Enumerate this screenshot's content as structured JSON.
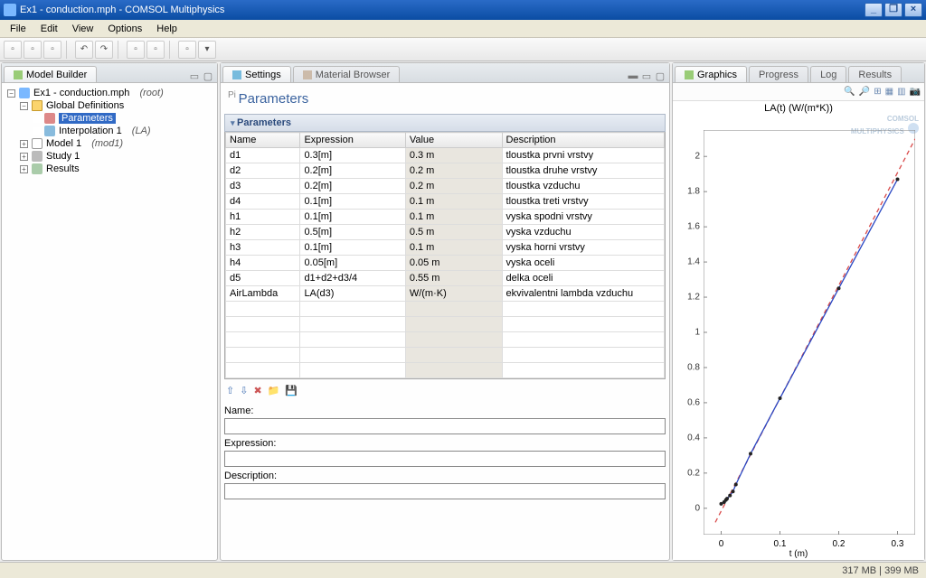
{
  "window": {
    "title": "Ex1 - conduction.mph - COMSOL Multiphysics"
  },
  "menu": [
    "File",
    "Edit",
    "View",
    "Options",
    "Help"
  ],
  "panels": {
    "model_builder": "Model Builder",
    "settings": "Settings",
    "material_browser": "Material Browser",
    "graphics": "Graphics",
    "progress": "Progress",
    "log": "Log",
    "results": "Results"
  },
  "tree": {
    "root": "Ex1 - conduction.mph",
    "root_suffix": "(root)",
    "global_defs": "Global Definitions",
    "parameters": "Parameters",
    "interpolation": "Interpolation 1",
    "interpolation_suffix": "(LA)",
    "model": "Model 1",
    "model_suffix": "(mod1)",
    "study": "Study 1",
    "results": "Results"
  },
  "params_title": "Parameters",
  "section_title": "Parameters",
  "columns": {
    "name": "Name",
    "expression": "Expression",
    "value": "Value",
    "description": "Description"
  },
  "rows": [
    {
      "n": "d1",
      "e": "0.3[m]",
      "v": "0.3 m",
      "d": "tloustka prvni vrstvy"
    },
    {
      "n": "d2",
      "e": "0.2[m]",
      "v": "0.2 m",
      "d": "tloustka druhe vrstvy"
    },
    {
      "n": "d3",
      "e": "0.2[m]",
      "v": "0.2 m",
      "d": "tloustka vzduchu"
    },
    {
      "n": "d4",
      "e": "0.1[m]",
      "v": "0.1 m",
      "d": "tloustka treti vrstvy"
    },
    {
      "n": "h1",
      "e": "0.1[m]",
      "v": "0.1 m",
      "d": "vyska spodni vrstvy"
    },
    {
      "n": "h2",
      "e": "0.5[m]",
      "v": "0.5 m",
      "d": "vyska vzduchu"
    },
    {
      "n": "h3",
      "e": "0.1[m]",
      "v": "0.1 m",
      "d": "vyska horni vrstvy"
    },
    {
      "n": "h4",
      "e": "0.05[m]",
      "v": "0.05 m",
      "d": "vyska oceli"
    },
    {
      "n": "d5",
      "e": "d1+d2+d3/4",
      "v": "0.55 m",
      "d": "delka oceli"
    },
    {
      "n": "AirLambda",
      "e": "LA(d3)",
      "v": "W/(m·K)",
      "d": "ekvivalentni lambda vzduchu"
    }
  ],
  "form": {
    "name": "Name:",
    "expression": "Expression:",
    "description": "Description:"
  },
  "status": "317 MB | 399 MB",
  "chart_data": {
    "type": "line",
    "title": "LA(t) (W/(m*K))",
    "xlabel": "t (m)",
    "xlim": [
      -0.03,
      0.33
    ],
    "ylim": [
      -0.15,
      2.15
    ],
    "yticks": [
      0,
      0.2,
      0.4,
      0.6,
      0.8,
      1,
      1.2,
      1.4,
      1.6,
      1.8,
      2
    ],
    "xticks": [
      0,
      0.1,
      0.2,
      0.3
    ],
    "series": [
      {
        "name": "red-dashed",
        "color": "#d94a4a",
        "dash": true,
        "x": [
          -0.01,
          0.33
        ],
        "y": [
          -0.08,
          2.1
        ]
      },
      {
        "name": "blue-line",
        "color": "#2947c3",
        "dash": false,
        "x": [
          0,
          0.005,
          0.008,
          0.01,
          0.015,
          0.02,
          0.025,
          0.05,
          0.1,
          0.2,
          0.3
        ],
        "y": [
          0.025,
          0.035,
          0.047,
          0.055,
          0.073,
          0.095,
          0.135,
          0.31,
          0.625,
          1.25,
          1.87
        ]
      }
    ],
    "markers": {
      "x": [
        0,
        0.005,
        0.008,
        0.01,
        0.015,
        0.02,
        0.025,
        0.05,
        0.1,
        0.2,
        0.3
      ],
      "y": [
        0.025,
        0.035,
        0.047,
        0.055,
        0.073,
        0.095,
        0.135,
        0.31,
        0.625,
        1.25,
        1.87
      ]
    }
  }
}
